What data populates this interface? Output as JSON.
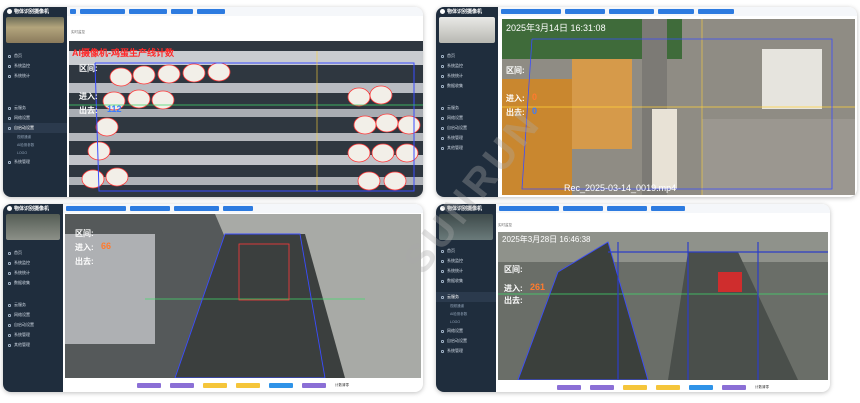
{
  "app": {
    "title": "物体识别摄像机"
  },
  "nav": {
    "items": [
      "首页",
      "系统监控",
      "系统统计",
      "数据收集",
      "云服务",
      "网络设置",
      "自启动设置",
      "系统管理",
      "其他管理"
    ],
    "subitems": [
      "视频通道",
      "AI检测参数",
      "LOGO"
    ]
  },
  "panels": {
    "top_left": {
      "breadcrumb": "实时监控",
      "overlay_title": "AI摄像机-鸡蛋生产线计数",
      "zone_label": "区间:",
      "in_label": "进入:",
      "out_label": "出去:",
      "out_value": "112"
    },
    "top_right": {
      "timestamp": "2025年3月14日  16:31:08",
      "zone_label": "区间:",
      "in_label": "进入:",
      "in_value": "0",
      "out_label": "出去:",
      "out_value": "0",
      "filename": "Rec_2025-03-14_0019.mp4"
    },
    "bottom_left": {
      "zone_label": "区间:",
      "in_label": "进入:",
      "in_value": "66",
      "out_label": "出去:"
    },
    "bottom_right": {
      "breadcrumb": "实时监控",
      "timestamp": "2025年3月28日  16:46:38",
      "zone_label": "区间:",
      "in_label": "进入:",
      "in_value": "261",
      "out_label": "出去:"
    }
  },
  "footer": {
    "extra_label": "计数清零"
  },
  "watermark": "SUNRUN",
  "colors": {
    "sidebar": "#1f2d3d",
    "accent": "#2d7be0",
    "count_in": "#ff7b2e",
    "count_out": "#3a7bff",
    "title_red": "#ff2a2a"
  }
}
